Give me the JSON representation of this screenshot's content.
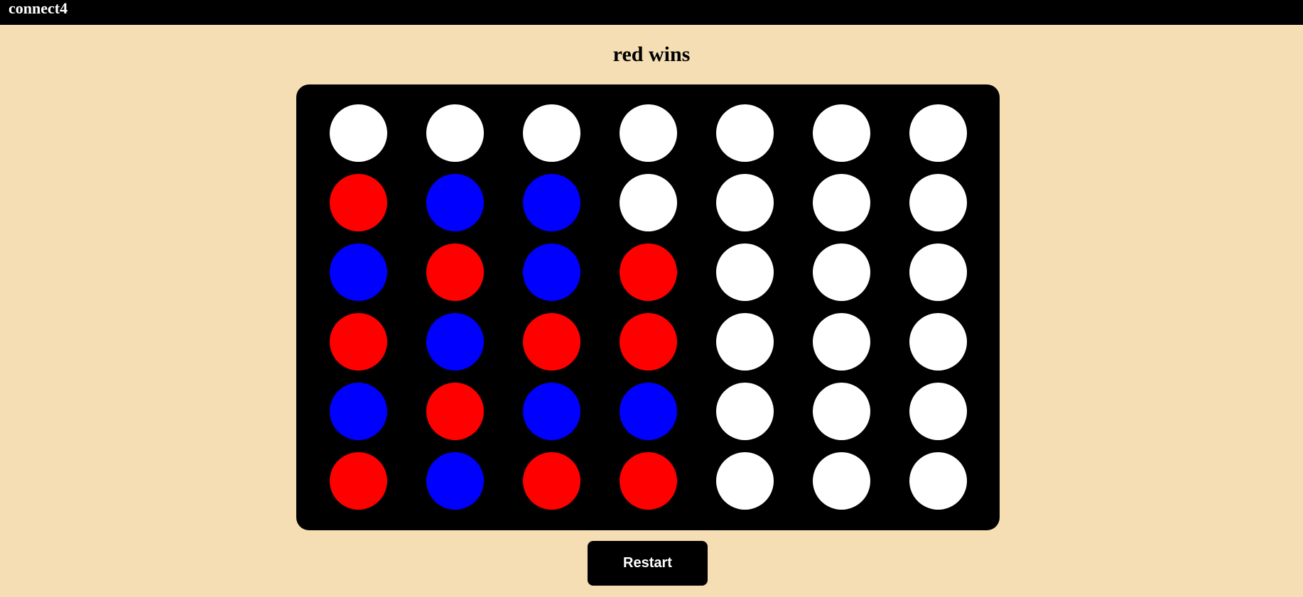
{
  "header": {
    "title": "connect4"
  },
  "game": {
    "status": "red wins",
    "players": [
      "red",
      "blue"
    ],
    "colors": {
      "red": "#ff0000",
      "blue": "#0000ff",
      "empty": "#ffffff",
      "board": "#000000",
      "background": "#f5deb3"
    },
    "board": [
      [
        "empty",
        "empty",
        "empty",
        "empty",
        "empty",
        "empty",
        "empty"
      ],
      [
        "red",
        "blue",
        "blue",
        "empty",
        "empty",
        "empty",
        "empty"
      ],
      [
        "blue",
        "red",
        "blue",
        "red",
        "empty",
        "empty",
        "empty"
      ],
      [
        "red",
        "blue",
        "red",
        "red",
        "empty",
        "empty",
        "empty"
      ],
      [
        "blue",
        "red",
        "blue",
        "blue",
        "empty",
        "empty",
        "empty"
      ],
      [
        "red",
        "blue",
        "red",
        "red",
        "empty",
        "empty",
        "empty"
      ]
    ]
  },
  "controls": {
    "restart_label": "Restart"
  }
}
